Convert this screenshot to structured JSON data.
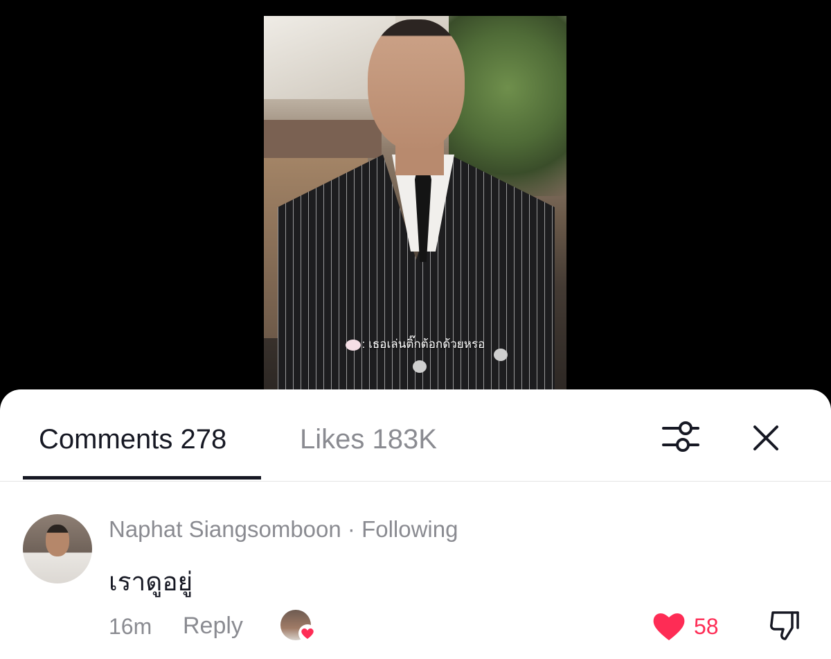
{
  "video": {
    "caption_text": ": เธอเล่นติ๊กต้อกด้วยหรอ",
    "caption_icon": "mouse-face-emoji"
  },
  "sheet": {
    "tabs": [
      {
        "label": "Comments 278",
        "active": true
      },
      {
        "label": "Likes 183K",
        "active": false
      }
    ],
    "filter_icon": "sliders-icon",
    "close_icon": "close-icon"
  },
  "comment": {
    "author_line": "Naphat Siangsomboon · Following",
    "text": "เราดูอยู่",
    "time": "16m",
    "reply_label": "Reply",
    "likes": "58",
    "liked_by_creator": true
  },
  "colors": {
    "accent_like": "#fe2c55",
    "text_primary": "#161823",
    "text_secondary": "#8a8b91"
  }
}
